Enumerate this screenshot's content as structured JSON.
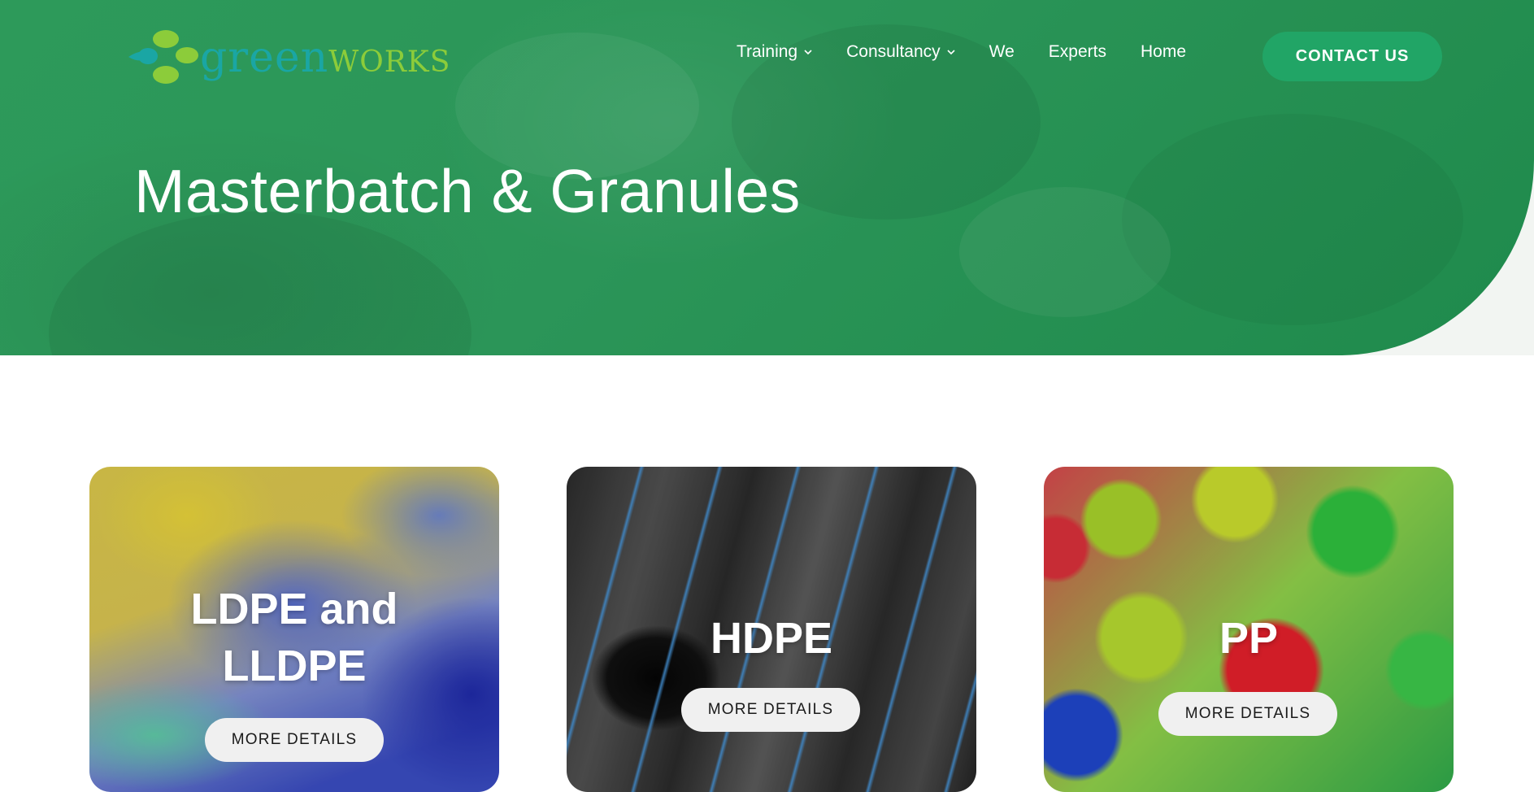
{
  "brand": {
    "logo_part1": "green",
    "logo_part2": "works",
    "colors": {
      "teal": "#1aa6a4",
      "lime": "#8ccc3a",
      "hero_green": "#2b9558",
      "button_green": "#21a566"
    }
  },
  "nav": {
    "items": [
      {
        "label": "Training",
        "has_dropdown": true,
        "icon": "chevron-down-icon"
      },
      {
        "label": "Consultancy",
        "has_dropdown": true,
        "icon": "chevron-down-icon"
      },
      {
        "label": "We",
        "has_dropdown": false
      },
      {
        "label": "Experts",
        "has_dropdown": false
      },
      {
        "label": "Home",
        "has_dropdown": false
      }
    ],
    "contact_label": "CONTACT US"
  },
  "hero": {
    "title": "Masterbatch & Granules"
  },
  "cards": [
    {
      "title": "LDPE and LLDPE",
      "button_label": "MORE DETAILS"
    },
    {
      "title": "HDPE",
      "button_label": "MORE DETAILS"
    },
    {
      "title": "PP",
      "button_label": "MORE DETAILS"
    }
  ]
}
